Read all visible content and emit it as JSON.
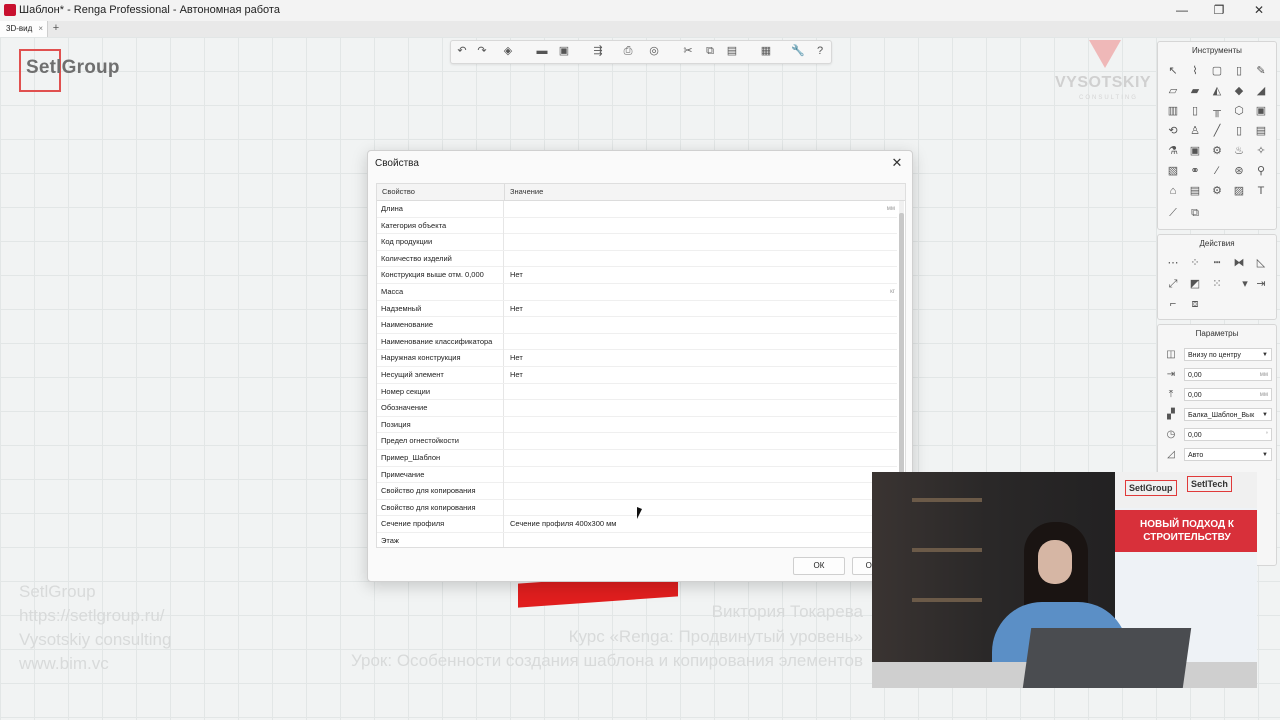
{
  "window": {
    "title": "Шаблон* - Renga Professional - Автономная работа",
    "controls": {
      "minimize": "—",
      "restore": "❐",
      "close": "✕"
    }
  },
  "tabs": [
    {
      "label": "3D-вид",
      "close": "×"
    }
  ],
  "tab_add": "+",
  "logo": {
    "text": "SetlGroup",
    "accent_color": "#e0504f"
  },
  "vysotskiy_logo": {
    "text": "VYSOTSKIY",
    "sub": "CONSULTING"
  },
  "toolbar": {
    "icons": [
      "undo-icon",
      "redo-icon",
      "view-cube-icon",
      "open-folder-icon",
      "save-icon",
      "export-icon",
      "print-icon",
      "navigation-icon",
      "cut-icon",
      "copy-icon",
      "paste-icon",
      "layers-icon",
      "wrench-icon",
      "help-icon"
    ],
    "glyphs": [
      "↶",
      "↷",
      "◈",
      "▬",
      "▣",
      "⇶",
      "⎙",
      "◎",
      "✂",
      "⧉",
      "▤",
      "▦",
      "🔧",
      "?"
    ]
  },
  "panels": {
    "instruments": {
      "title": "Инструменты"
    },
    "actions": {
      "title": "Действия"
    },
    "parameters": {
      "title": "Параметры",
      "rows": [
        {
          "value": "Внизу по центру",
          "type": "select"
        },
        {
          "value": "0,00",
          "unit": "мм",
          "type": "number"
        },
        {
          "value": "0,00",
          "unit": "мм",
          "type": "number"
        },
        {
          "value": "Балка_Шаблон_Вык",
          "type": "select"
        },
        {
          "value": "0,00",
          "unit": "°",
          "type": "number"
        },
        {
          "value": "Авто",
          "type": "select"
        }
      ]
    }
  },
  "dialog": {
    "title": "Свойства",
    "close": "✕",
    "columns": {
      "property": "Свойство",
      "value": "Значение"
    },
    "rows": [
      {
        "name": "Длина",
        "value": "",
        "unit": "мм"
      },
      {
        "name": "Категория объекта",
        "value": ""
      },
      {
        "name": "Код продукции",
        "value": ""
      },
      {
        "name": "Количество изделий",
        "value": ""
      },
      {
        "name": "Конструкция выше отм. 0,000",
        "value": "Нет"
      },
      {
        "name": "Масса",
        "value": "",
        "unit": "кг"
      },
      {
        "name": "Надземный",
        "value": "Нет"
      },
      {
        "name": "Наименование",
        "value": ""
      },
      {
        "name": "Наименование классификатора",
        "value": ""
      },
      {
        "name": "Наружная конструкция",
        "value": "Нет"
      },
      {
        "name": "Несущий элемент",
        "value": "Нет"
      },
      {
        "name": "Номер секции",
        "value": ""
      },
      {
        "name": "Обозначение",
        "value": ""
      },
      {
        "name": "Позиция",
        "value": ""
      },
      {
        "name": "Предел огнестойкости",
        "value": ""
      },
      {
        "name": "Пример_Шаблон",
        "value": ""
      },
      {
        "name": "Примечание",
        "value": ""
      },
      {
        "name": "Свойство для копирования",
        "value": ""
      },
      {
        "name": "Свойство для копирования",
        "value": ""
      },
      {
        "name": "Сечение профиля",
        "value": "Сечение профиля 400x300 мм"
      },
      {
        "name": "Этаж",
        "value": ""
      }
    ],
    "ok_label": "ОК",
    "cancel_label": "Отмена"
  },
  "watermark": {
    "left": [
      "SetlGroup",
      "https://setlgroup.ru/",
      "Vysotskiy consulting",
      "www.bim.vc"
    ],
    "right": [
      "Виктория Токарева",
      "Курс «Renga: Продвинутый уровень»",
      "Урок: Особенности создания шаблона и копирования элементов"
    ]
  },
  "video": {
    "banner_logo_1": "SetlGroup",
    "banner_logo_2": "SetlTech",
    "banner_text": "НОВЫЙ ПОДХОД К СТРОИТЕЛЬСТВУ",
    "banner_color": "#d8303a"
  }
}
